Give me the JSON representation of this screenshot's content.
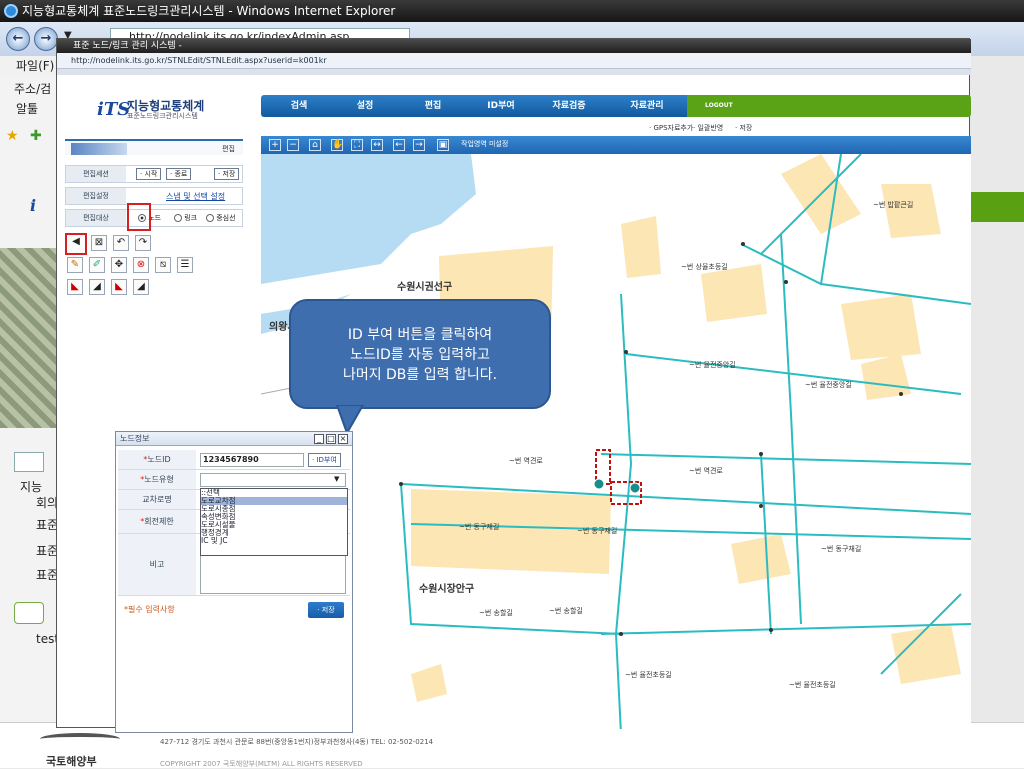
{
  "browser": {
    "window_title": "지능형교통체계 표준노드링크관리시스템 - Windows Internet Explorer",
    "address": "http://nodelink.its.go.kr/indexAdmin.asp",
    "menu_file": "파일(F)",
    "left_strip_items": [
      "주소/검",
      "알툴"
    ],
    "left_bottom_items": [
      "지능",
      "회의",
      "표준",
      "표준",
      "표준",
      "test"
    ]
  },
  "popup": {
    "title": "표준 노드/링크 관리 시스템 -",
    "address": "http://nodelink.its.go.kr/STNLEdit/STNLEdit.aspx?userid=k001kr"
  },
  "header": {
    "logo_mark": "iTS",
    "logo_title": "지능형교통체계",
    "logo_sub": "표준노드링크관리시스템",
    "menu": [
      "검색",
      "설정",
      "편집",
      "ID부여",
      "자료검증",
      "자료관리"
    ],
    "logout": "LOGOUT",
    "submenu": [
      "· GPS자료추가",
      "· 일괄반영",
      "· 저장"
    ]
  },
  "edit_panel": {
    "header_label": "편집",
    "session_label": "편집세션",
    "session_buttons": [
      "· 시작",
      "· 종료",
      "· 저장"
    ],
    "setting_label": "편집설정",
    "setting_link": "스냅 및 선택 설정",
    "target_label": "편집대상",
    "target_options": [
      "노드",
      "링크",
      "중심선"
    ]
  },
  "map": {
    "status": "작업영역 미설정",
    "labels": {
      "area1": "수원시권선구",
      "area2": "의왕시",
      "area3": "수원시장안구",
      "road1": "~번 역견로",
      "road2": "~번 역견로",
      "road3": "~번 동구재길",
      "road4": "~번 동구재길",
      "road5": "~번 동구재길",
      "road6": "~번 송할길",
      "road7": "~번 송할길",
      "road8": "~번 율전중앙길",
      "road9": "~번 율전중앙길",
      "road10": "~번 율전초등길",
      "road11": "~번 율전초등길",
      "road12": "~번 밥팥큰길",
      "road13": "~번 상율초등길"
    }
  },
  "callout": {
    "line1": "ID 부여 버튼을 클릭하여",
    "line2": "노드ID를 자동 입력하고",
    "line3": "나머지 DB를 입력 합니다."
  },
  "node_info": {
    "title": "노드정보",
    "node_id_label": "노드ID",
    "node_id_value": "1234567890",
    "id_button": "· ID부여",
    "node_type_label": "노드유형",
    "cross_name_label": "교차로명",
    "turn_limit_label": "회전제한",
    "note_label": "비고",
    "type_options": [
      "::선택",
      "도로교차점",
      "도로시종점",
      "속성변화점",
      "도로시설물",
      "행정경계",
      "IC 및 JC"
    ],
    "required_note": "*필수 입력사항",
    "save_button": "· 저장"
  },
  "footer": {
    "address": "427-712 경기도 과천시 관문로 88번(중앙동1번지)정부과천청사(4동)  TEL: 02-502-0214",
    "copyright": "COPYRIGHT 2007 국토해양부(MLTM) ALL RIGHTS RESERVED",
    "ministry": "국토해양부"
  },
  "colors": {
    "menu_blue": "#1f6ab6",
    "logout_green": "#5aa316",
    "road_cyan": "#2bbcc0",
    "block_tan": "#fbe6b4",
    "water_blue": "#b6dcf4",
    "callout_blue": "#3f6eae",
    "highlight_red": "#c01010"
  }
}
